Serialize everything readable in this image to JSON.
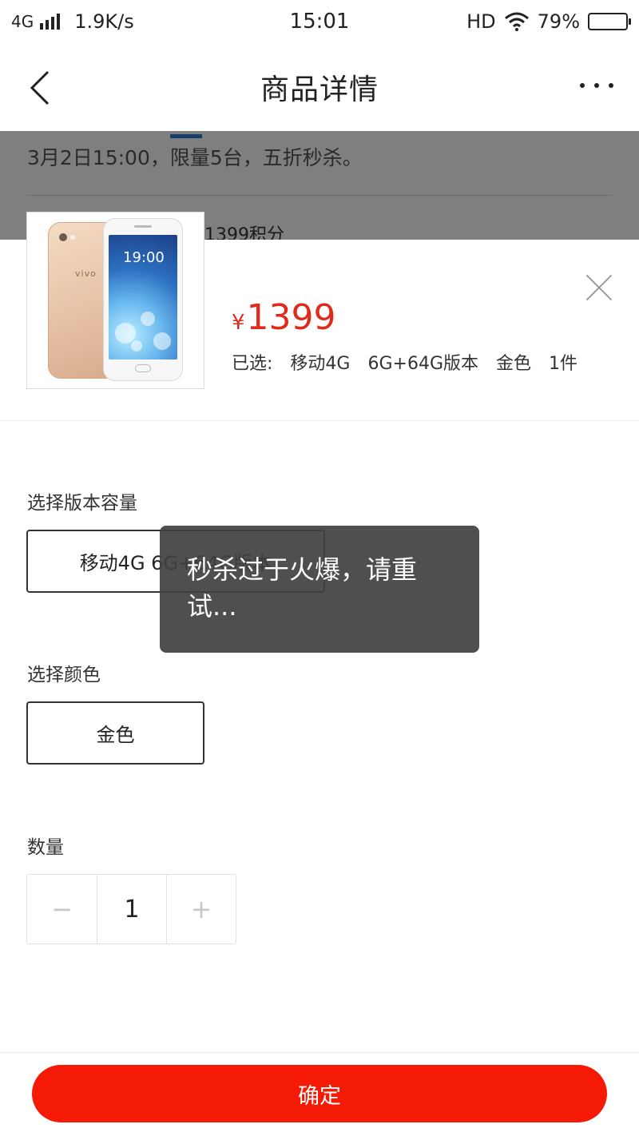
{
  "status_bar": {
    "network": "4G",
    "speed": "1.9K/s",
    "time": "15:01",
    "hd": "HD",
    "battery": "79%",
    "battery_level": 0.79
  },
  "header": {
    "title": "商品详情"
  },
  "background_page": {
    "promo_text": "3月2日15:00，限量5台，五折秒杀。",
    "points_text": "1399积分"
  },
  "product": {
    "image_icon": "phone-product-image",
    "brand_mark": "vivo",
    "screen_time": "19:00",
    "price_symbol": "¥",
    "price": "1399",
    "selected_label": "已选:",
    "selected": {
      "network": "移动4G",
      "version": "6G+64G版本",
      "color": "金色",
      "quantity": "1件"
    }
  },
  "version_section": {
    "label": "选择版本容量",
    "option": "移动4G 6G+64G版本"
  },
  "color_section": {
    "label": "选择颜色",
    "option": "金色"
  },
  "quantity_section": {
    "label": "数量",
    "minus": "−",
    "value": "1",
    "plus": "+"
  },
  "confirm_label": "确定",
  "toast": {
    "message": "秒杀过于火爆，请重试..."
  },
  "colors": {
    "price_red": "#e02a1c",
    "confirm_red": "#f51a05",
    "tab_indicator_blue": "#2a7fd4"
  }
}
